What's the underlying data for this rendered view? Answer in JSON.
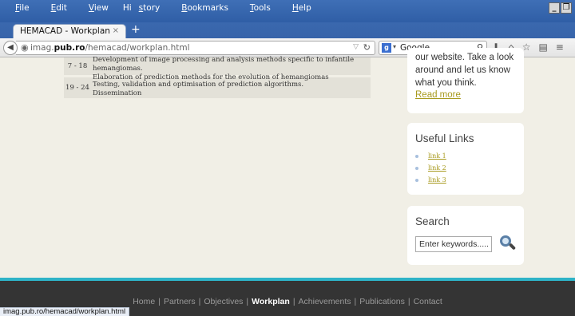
{
  "browser": {
    "menu": [
      {
        "pre": "",
        "key": "F",
        "post": "ile"
      },
      {
        "pre": "",
        "key": "E",
        "post": "dit"
      },
      {
        "pre": "",
        "key": "V",
        "post": "iew"
      },
      {
        "pre": "Hi",
        "key": "s",
        "post": "tory"
      },
      {
        "pre": "",
        "key": "B",
        "post": "ookmarks"
      },
      {
        "pre": "",
        "key": "T",
        "post": "ools"
      },
      {
        "pre": "",
        "key": "H",
        "post": "elp"
      }
    ],
    "tab_title": "HEMACAD - Workplan",
    "tab_close": "×",
    "new_tab": "+",
    "url_domain_pre": "imag.",
    "url_domain": "pub.ro",
    "url_path": "/hemacad/workplan.html",
    "search_engine": "Google",
    "status_url": "imag.pub.ro/hemacad/workplan.html"
  },
  "workplan": {
    "rows": [
      {
        "period": "7 - 18",
        "lines": [
          "Development of image processing and analysis methods specific to infantile hemangiomas.",
          "Elaboration of prediction methods for the evolution of hemangiomas"
        ]
      },
      {
        "period": "19 - 24",
        "lines": [
          "Testing, validation and optimisation of prediction algorithms.",
          "Dissemination"
        ]
      }
    ]
  },
  "sidebar": {
    "about": {
      "line0": "our website. Take a look",
      "line1": "around and let us know",
      "line2": "what you think.",
      "read_more": "Read more"
    },
    "useful_links": {
      "title": "Useful Links",
      "links": [
        "link 1",
        "link 2",
        "link 3"
      ]
    },
    "search": {
      "title": "Search",
      "placeholder": "Enter keywords....."
    }
  },
  "footer": {
    "nav": [
      "Home",
      "Partners",
      "Objectives",
      "Workplan",
      "Achievements",
      "Publications",
      "Contact"
    ],
    "active": "Workplan",
    "separator": "|"
  },
  "colors": {
    "accent": "#a89a1e",
    "footer_bar": "#2eb3c7",
    "footer_bg": "#343434",
    "page_bg": "#f1efe6"
  }
}
